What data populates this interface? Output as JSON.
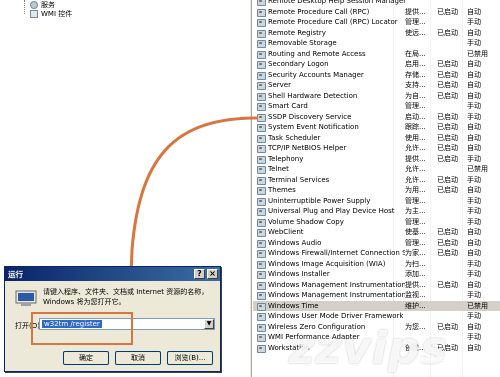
{
  "tree": {
    "items": [
      {
        "label": "服务"
      },
      {
        "label": "WMI 控件"
      }
    ]
  },
  "services": [
    {
      "name": "Remote Desktop Help Session Manager",
      "desc": "",
      "status": "",
      "startup": ""
    },
    {
      "name": "Remote Procedure Call (RPC)",
      "desc": "提供...",
      "status": "已启动",
      "startup": "自动"
    },
    {
      "name": "Remote Procedure Call (RPC) Locator",
      "desc": "管理...",
      "status": "",
      "startup": "手动"
    },
    {
      "name": "Remote Registry",
      "desc": "使远...",
      "status": "已启动",
      "startup": "自动"
    },
    {
      "name": "Removable Storage",
      "desc": "",
      "status": "",
      "startup": "手动"
    },
    {
      "name": "Routing and Remote Access",
      "desc": "在局...",
      "status": "",
      "startup": "已禁用"
    },
    {
      "name": "Secondary Logon",
      "desc": "启用...",
      "status": "已启动",
      "startup": "自动"
    },
    {
      "name": "Security Accounts Manager",
      "desc": "存储...",
      "status": "已启动",
      "startup": "自动"
    },
    {
      "name": "Server",
      "desc": "支持...",
      "status": "已启动",
      "startup": "自动"
    },
    {
      "name": "Shell Hardware Detection",
      "desc": "为自...",
      "status": "已启动",
      "startup": "自动"
    },
    {
      "name": "Smart Card",
      "desc": "管理...",
      "status": "",
      "startup": "手动"
    },
    {
      "name": "SSDP Discovery Service",
      "desc": "启动...",
      "status": "已启动",
      "startup": "手动"
    },
    {
      "name": "System Event Notification",
      "desc": "跟踪...",
      "status": "已启动",
      "startup": "自动"
    },
    {
      "name": "Task Scheduler",
      "desc": "使用...",
      "status": "已启动",
      "startup": "自动"
    },
    {
      "name": "TCP/IP NetBIOS Helper",
      "desc": "允许...",
      "status": "已启动",
      "startup": "自动"
    },
    {
      "name": "Telephony",
      "desc": "提供...",
      "status": "已启动",
      "startup": "手动"
    },
    {
      "name": "Telnet",
      "desc": "允许...",
      "status": "",
      "startup": "已禁用"
    },
    {
      "name": "Terminal Services",
      "desc": "允许...",
      "status": "已启动",
      "startup": "手动"
    },
    {
      "name": "Themes",
      "desc": "为用...",
      "status": "已启动",
      "startup": "自动"
    },
    {
      "name": "Uninterruptible Power Supply",
      "desc": "管理...",
      "status": "",
      "startup": "手动"
    },
    {
      "name": "Universal Plug and Play Device Host",
      "desc": "为主...",
      "status": "",
      "startup": "手动"
    },
    {
      "name": "Volume Shadow Copy",
      "desc": "管理...",
      "status": "",
      "startup": "手动"
    },
    {
      "name": "WebClient",
      "desc": "使基...",
      "status": "已启动",
      "startup": "自动"
    },
    {
      "name": "Windows Audio",
      "desc": "管理...",
      "status": "已启动",
      "startup": "自动"
    },
    {
      "name": "Windows Firewall/Internet Connection Sha...",
      "desc": "为家...",
      "status": "已启动",
      "startup": "自动"
    },
    {
      "name": "Windows Image Acquisition (WIA)",
      "desc": "为扫...",
      "status": "",
      "startup": "手动"
    },
    {
      "name": "Windows Installer",
      "desc": "添加...",
      "status": "",
      "startup": "手动"
    },
    {
      "name": "Windows Management Instrumentation",
      "desc": "提供...",
      "status": "已启动",
      "startup": "自动"
    },
    {
      "name": "Windows Management Instrumentation Dri...",
      "desc": "监视...",
      "status": "",
      "startup": "手动"
    },
    {
      "name": "Windows Time",
      "desc": "维护...",
      "status": "",
      "startup": "已禁用",
      "selected": true
    },
    {
      "name": "Windows User Mode Driver Framework",
      "desc": "",
      "status": "",
      "startup": "手动"
    },
    {
      "name": "Wireless Zero Configuration",
      "desc": "为您...",
      "status": "已启动",
      "startup": "自动"
    },
    {
      "name": "WMI Performance Adapter",
      "desc": "",
      "status": "",
      "startup": "手动"
    },
    {
      "name": "Workstation",
      "desc": "创建...",
      "status": "已启动",
      "startup": "自动"
    }
  ],
  "run_dialog": {
    "title": "运行",
    "message": "请键入程序、文件夹、文档或 Internet 资源的名称，Windows 将为您打开它。",
    "open_label": "打开(O):",
    "open_value": "w32tm /register",
    "ok_label": "确定",
    "cancel_label": "取消",
    "browse_label": "浏览(B)..."
  },
  "watermark": {
    "text": "zzvips",
    "sub": "www.zzvips.com"
  },
  "colors": {
    "annotation": "#d9763f",
    "titlebar": "#0a246a",
    "selection": "#316ac5"
  }
}
